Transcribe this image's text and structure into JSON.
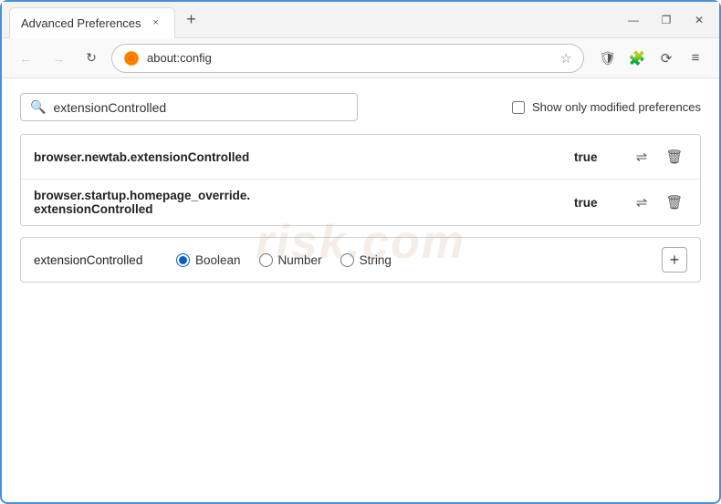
{
  "titleBar": {
    "tab": {
      "title": "Advanced Preferences",
      "closeLabel": "×"
    },
    "newTabLabel": "+",
    "windowControls": {
      "minimizeLabel": "—",
      "restoreLabel": "❐",
      "closeLabel": "✕"
    }
  },
  "addressBar": {
    "backTitle": "Back",
    "forwardTitle": "Forward",
    "reloadTitle": "Reload",
    "browserName": "Firefox",
    "url": "about:config",
    "bookmarkTitle": "Bookmark",
    "shieldTitle": "Shield",
    "extensionTitle": "Extension",
    "syncTitle": "Sync",
    "menuTitle": "Menu",
    "starSymbol": "☆",
    "shieldSymbol": "🛡",
    "menuSymbol": "≡"
  },
  "main": {
    "searchPlaceholder": "extensionControlled",
    "searchValue": "extensionControlled",
    "showModifiedLabel": "Show only modified preferences",
    "watermark": "risk.com",
    "results": [
      {
        "name": "browser.newtab.extensionControlled",
        "value": "true"
      },
      {
        "name": "browser.startup.homepage_override.\nextensionControlled",
        "nameLine1": "browser.startup.homepage_override.",
        "nameLine2": "extensionControlled",
        "multiline": true,
        "value": "true"
      }
    ],
    "addPref": {
      "name": "extensionControlled",
      "typeOptions": [
        {
          "label": "Boolean",
          "value": "boolean",
          "checked": true
        },
        {
          "label": "Number",
          "value": "number",
          "checked": false
        },
        {
          "label": "String",
          "value": "string",
          "checked": false
        }
      ],
      "addLabel": "+"
    }
  }
}
